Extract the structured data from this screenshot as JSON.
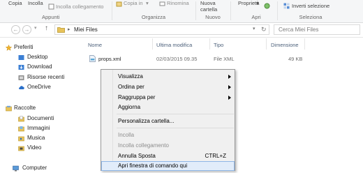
{
  "ribbon": {
    "copy_label": "Copia",
    "paste_label": "Incolla",
    "paste_link_label": "Incolla collegamento",
    "copy_to_label": "Copia in",
    "rename_label": "Rinomina",
    "new_folder_line1": "Nuova",
    "new_folder_line2": "cartella",
    "properties_label": "Proprietà",
    "invert_selection_label": "Inverti selezione",
    "groups": {
      "clipboard": "Appunti",
      "organize": "Organizza",
      "new": "Nuovo",
      "open": "Apri",
      "select": "Seleziona"
    }
  },
  "address": {
    "back_glyph": "←",
    "forward_glyph": "→",
    "up_glyph": "↑",
    "separator": "▸",
    "path": "Miei Files",
    "dropdown_glyph": "▾",
    "refresh_glyph": "↻",
    "search_placeholder": "Cerca Miei Files"
  },
  "sidebar": {
    "favorites": {
      "label": "Preferiti",
      "items": [
        "Desktop",
        "Download",
        "Risorse recenti",
        "OneDrive"
      ]
    },
    "libraries": {
      "label": "Raccolte",
      "items": [
        "Documenti",
        "Immagini",
        "Musica",
        "Video"
      ]
    },
    "computer": "Computer"
  },
  "columns": {
    "name": "Nome",
    "modified": "Ultima modifica",
    "type": "Tipo",
    "size": "Dimensione"
  },
  "files": [
    {
      "name": "props.xml",
      "modified": "02/03/2015 09.35",
      "type": "File XML",
      "size": "49 KB"
    }
  ],
  "context_menu": {
    "items": [
      {
        "label": "Visualizza",
        "submenu": true,
        "disabled": false
      },
      {
        "label": "Ordina per",
        "submenu": true,
        "disabled": false
      },
      {
        "label": "Raggruppa per",
        "submenu": true,
        "disabled": false
      },
      {
        "label": "Aggiorna",
        "submenu": false,
        "disabled": false
      },
      {
        "label": "Personalizza cartella...",
        "submenu": false,
        "disabled": false
      },
      {
        "label": "Incolla",
        "submenu": false,
        "disabled": true
      },
      {
        "label": "Incolla collegamento",
        "submenu": false,
        "disabled": true
      },
      {
        "label": "Annulla Sposta",
        "shortcut": "CTRL+Z",
        "submenu": false,
        "disabled": false
      },
      {
        "label": "Apri finestra di comando qui",
        "submenu": false,
        "disabled": false,
        "highlighted": true
      }
    ]
  },
  "colors": {
    "folder": "#e8c35a",
    "accent": "#3a74c4",
    "highlight": "#e1ecfa"
  }
}
